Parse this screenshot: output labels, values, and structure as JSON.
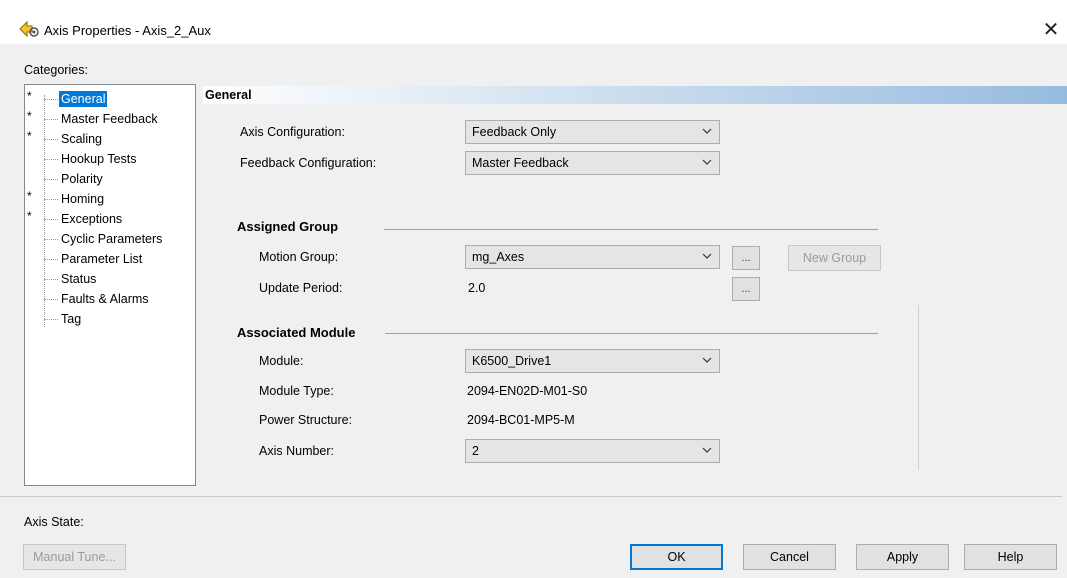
{
  "window": {
    "title": "Axis Properties - Axis_2_Aux",
    "icon": "axis-properties-icon",
    "close_icon": "close-icon"
  },
  "categories": {
    "label": "Categories:",
    "items": [
      {
        "label": "General",
        "starred": "*",
        "selected": true
      },
      {
        "label": "Master Feedback",
        "starred": "*"
      },
      {
        "label": "Scaling",
        "starred": "*"
      },
      {
        "label": "Hookup Tests",
        "starred": ""
      },
      {
        "label": "Polarity",
        "starred": ""
      },
      {
        "label": "Homing",
        "starred": "*"
      },
      {
        "label": "Exceptions",
        "starred": "*"
      },
      {
        "label": "Cyclic Parameters",
        "starred": ""
      },
      {
        "label": "Parameter List",
        "starred": ""
      },
      {
        "label": "Status",
        "starred": ""
      },
      {
        "label": "Faults & Alarms",
        "starred": ""
      },
      {
        "label": "Tag",
        "starred": ""
      }
    ]
  },
  "general": {
    "title": "General",
    "axis_configuration": {
      "label": "Axis Configuration:",
      "value": "Feedback Only"
    },
    "feedback_configuration": {
      "label": "Feedback Configuration:",
      "value": "Master Feedback"
    }
  },
  "assigned_group": {
    "title": "Assigned Group",
    "motion_group": {
      "label": "Motion Group:",
      "value": "mg_Axes"
    },
    "browse_label": "...",
    "new_group_label": "New Group",
    "update_period": {
      "label": "Update Period:",
      "value": "2.0"
    }
  },
  "associated_module": {
    "title": "Associated Module",
    "module": {
      "label": "Module:",
      "value": "K6500_Drive1"
    },
    "module_type": {
      "label": "Module Type:",
      "value": "2094-EN02D-M01-S0"
    },
    "power_structure": {
      "label": "Power Structure:",
      "value": "2094-BC01-MP5-M"
    },
    "axis_number": {
      "label": "Axis Number:",
      "value": "2"
    }
  },
  "footer": {
    "axis_state_label": "Axis State:",
    "manual_tune_label": "Manual Tune...",
    "ok_label": "OK",
    "cancel_label": "Cancel",
    "apply_label": "Apply",
    "help_label": "Help"
  },
  "colors": {
    "selection": "#0078d7",
    "section_bar_end": "#97bbe0"
  }
}
